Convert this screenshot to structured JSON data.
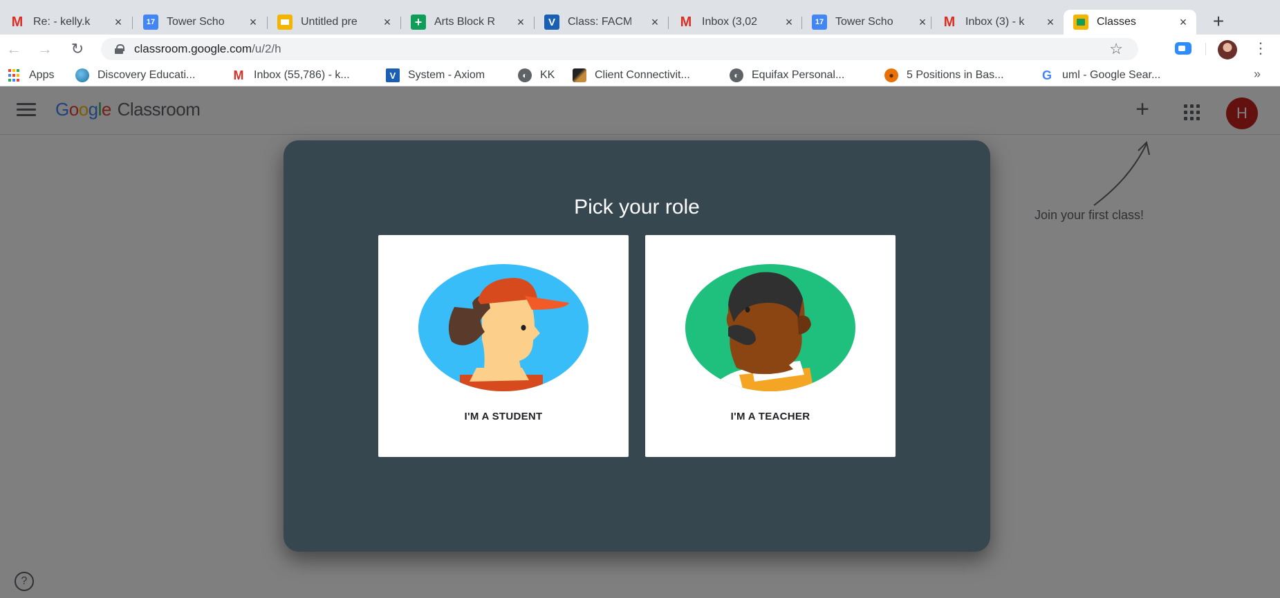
{
  "browser": {
    "tabs": [
      {
        "title": "Re: - kelly.k",
        "icon": "gmail-icon"
      },
      {
        "title": "Tower Scho",
        "icon": "calendar-icon"
      },
      {
        "title": "Untitled pre",
        "icon": "slides-icon"
      },
      {
        "title": "Arts Block R",
        "icon": "sheets-icon"
      },
      {
        "title": "Class: FACM",
        "icon": "v-icon"
      },
      {
        "title": "Inbox (3,02",
        "icon": "gmail-icon"
      },
      {
        "title": "Tower Scho",
        "icon": "calendar-icon"
      },
      {
        "title": "Inbox (3) - k",
        "icon": "gmail-icon"
      },
      {
        "title": "Classes",
        "icon": "classroom-icon"
      }
    ],
    "calendar_day": "17",
    "url_host": "classroom.google.com",
    "url_path": "/u/2/h",
    "bookmarks": [
      {
        "label": "Apps"
      },
      {
        "label": "Discovery Educati..."
      },
      {
        "label": "Inbox (55,786) - k..."
      },
      {
        "label": "System - Axiom"
      },
      {
        "label": "KK"
      },
      {
        "label": "Client Connectivit..."
      },
      {
        "label": "Equifax Personal..."
      },
      {
        "label": "5 Positions in Bas..."
      },
      {
        "label": "uml - Google Sear..."
      }
    ],
    "bookmarks_more": "»"
  },
  "classroom": {
    "logo_word": "Classroom",
    "account_initial": "H",
    "join_hint": "Join your first class!",
    "help_glyph": "?"
  },
  "dialog": {
    "title": "Pick your role",
    "student_label": "I'M A STUDENT",
    "teacher_label": "I'M A TEACHER"
  },
  "colors": {
    "dialog_bg": "#37474f",
    "student_circle": "#38bdf8",
    "teacher_circle": "#1fbf7e",
    "account_avatar": "#c5221f"
  }
}
